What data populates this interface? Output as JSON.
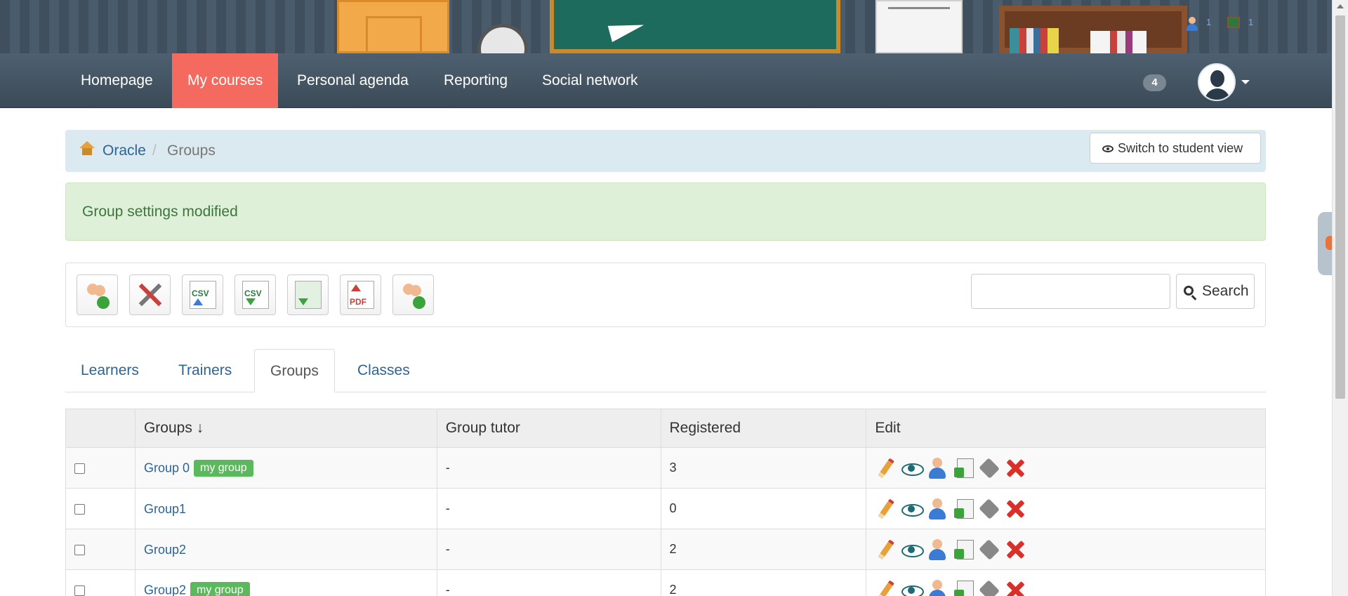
{
  "banner": {
    "user_count": "1",
    "course_count": "1"
  },
  "navbar": {
    "items": [
      {
        "label": "Homepage"
      },
      {
        "label": "My courses",
        "active": true
      },
      {
        "label": "Personal agenda"
      },
      {
        "label": "Reporting"
      },
      {
        "label": "Social network"
      }
    ],
    "notification_count": "4"
  },
  "breadcrumb": {
    "course": "Oracle",
    "current": "Groups",
    "separator": "/"
  },
  "student_view_button": "Switch to student view",
  "alert": {
    "message": "Group settings modified"
  },
  "toolbar": {
    "icons": [
      "add-group-icon",
      "tools-icon",
      "csv-import-icon",
      "csv-export-icon",
      "excel-export-icon",
      "pdf-export-icon",
      "group-overview-icon"
    ],
    "csv_label": "CSV",
    "pdf_label": "PDF",
    "search_placeholder": "",
    "search_label": "Search"
  },
  "tabs": [
    {
      "label": "Learners"
    },
    {
      "label": "Trainers"
    },
    {
      "label": "Groups",
      "active": true
    },
    {
      "label": "Classes"
    }
  ],
  "table": {
    "columns": [
      "Groups ↓",
      "Group tutor",
      "Registered",
      "Edit"
    ],
    "rows": [
      {
        "name": "Group 0",
        "badge": "my group",
        "tutor": "-",
        "registered": "3"
      },
      {
        "name": "Group1",
        "badge": "",
        "tutor": "-",
        "registered": "0"
      },
      {
        "name": "Group2",
        "badge": "",
        "tutor": "-",
        "registered": "2"
      },
      {
        "name": "Group2",
        "badge": "my group",
        "tutor": "-",
        "registered": "2"
      }
    ],
    "row_actions": [
      "edit-icon",
      "view-icon",
      "members-icon",
      "import-icon",
      "tag-icon",
      "delete-icon"
    ]
  },
  "colors": {
    "nav_active": "#f46a5e",
    "link": "#2c6494",
    "badge_green": "#5cb85c",
    "alert_bg": "#dff0d8"
  }
}
